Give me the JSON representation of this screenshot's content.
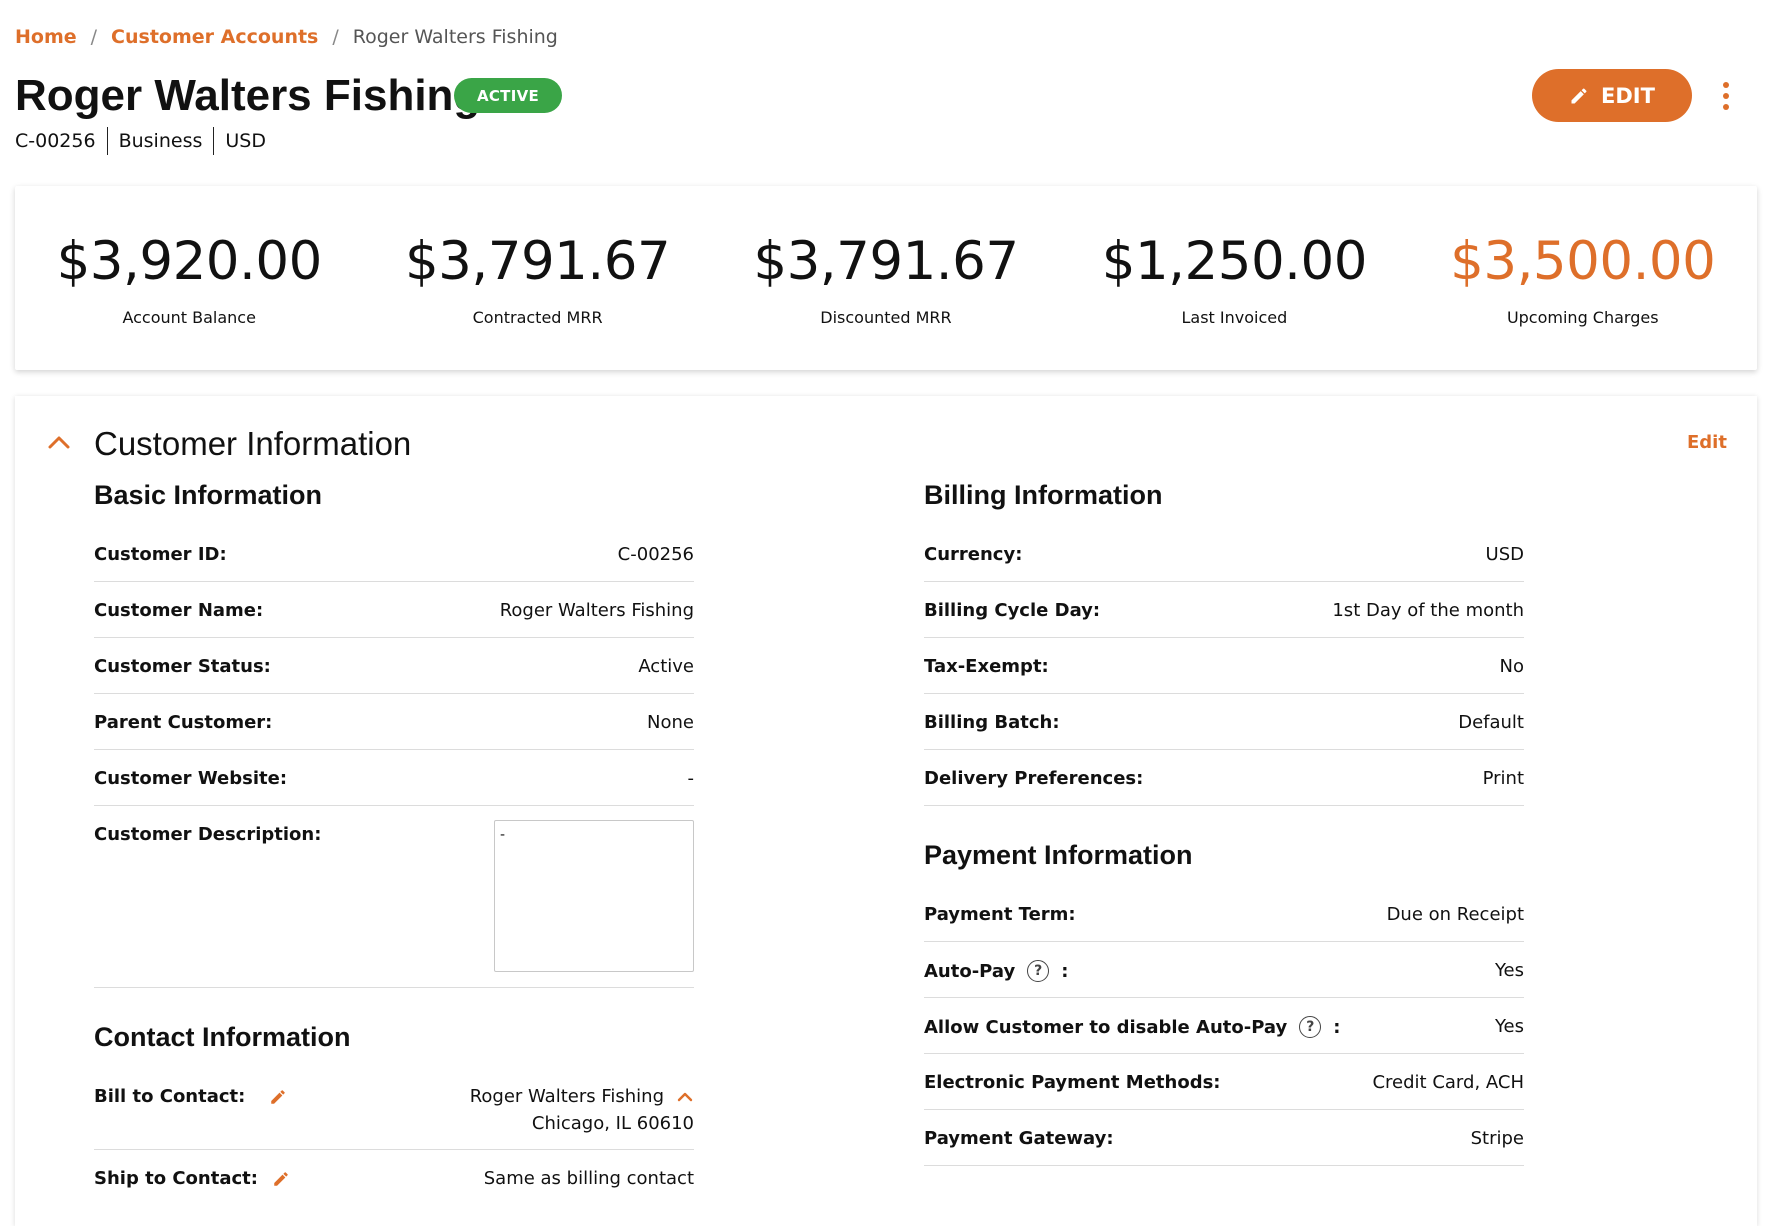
{
  "breadcrumb": {
    "home": "Home",
    "accounts": "Customer Accounts",
    "current": "Roger Walters Fishing",
    "separator": "/"
  },
  "header": {
    "title": "Roger Walters Fishing",
    "status_badge": "ACTIVE",
    "meta": [
      "C-00256",
      "Business",
      "USD"
    ],
    "edit_label": "EDIT"
  },
  "metrics": [
    {
      "value": "$3,920.00",
      "label": "Account Balance"
    },
    {
      "value": "$3,791.67",
      "label": "Contracted MRR"
    },
    {
      "value": "$3,791.67",
      "label": "Discounted MRR"
    },
    {
      "value": "$1,250.00",
      "label": "Last Invoiced"
    },
    {
      "value": "$3,500.00",
      "label": "Upcoming Charges"
    }
  ],
  "customer_info": {
    "title": "Customer Information",
    "edit_link": "Edit",
    "basic": {
      "title": "Basic Information",
      "rows": [
        {
          "label": "Customer ID:",
          "value": "C-00256"
        },
        {
          "label": "Customer Name:",
          "value": "Roger Walters Fishing"
        },
        {
          "label": "Customer Status:",
          "value": "Active"
        },
        {
          "label": "Parent Customer:",
          "value": "None"
        },
        {
          "label": "Customer Website:",
          "value": "-"
        },
        {
          "label": "Customer Description:",
          "value": "-"
        }
      ]
    },
    "contact": {
      "title": "Contact Information",
      "bill_label": "Bill to Contact:",
      "bill_name": "Roger Walters Fishing",
      "bill_address": "Chicago, IL 60610",
      "ship_label": "Ship to Contact:",
      "ship_value": "Same as billing contact"
    },
    "billing": {
      "title": "Billing Information",
      "rows": [
        {
          "label": "Currency:",
          "value": "USD"
        },
        {
          "label": "Billing Cycle Day:",
          "value": "1st Day of the month"
        },
        {
          "label": "Tax-Exempt:",
          "value": "No"
        },
        {
          "label": "Billing Batch:",
          "value": "Default"
        },
        {
          "label": "Delivery Preferences:",
          "value": "Print"
        }
      ]
    },
    "payment": {
      "title": "Payment Information",
      "help_glyph": "?",
      "colon": ":",
      "rows": [
        {
          "label": "Payment Term:",
          "value": "Due on Receipt"
        },
        {
          "label": "Auto-Pay",
          "value": "Yes"
        },
        {
          "label": "Allow Customer to disable Auto-Pay",
          "value": "Yes"
        },
        {
          "label": "Electronic Payment Methods:",
          "value": "Credit Card, ACH"
        },
        {
          "label": "Payment Gateway:",
          "value": "Stripe"
        }
      ]
    }
  },
  "colors": {
    "accent": "#de6f2a",
    "success": "#3aa547"
  },
  "icons": [
    "pencil-icon",
    "kebab-menu-icon",
    "chevron-up-icon",
    "help-circle-icon"
  ]
}
